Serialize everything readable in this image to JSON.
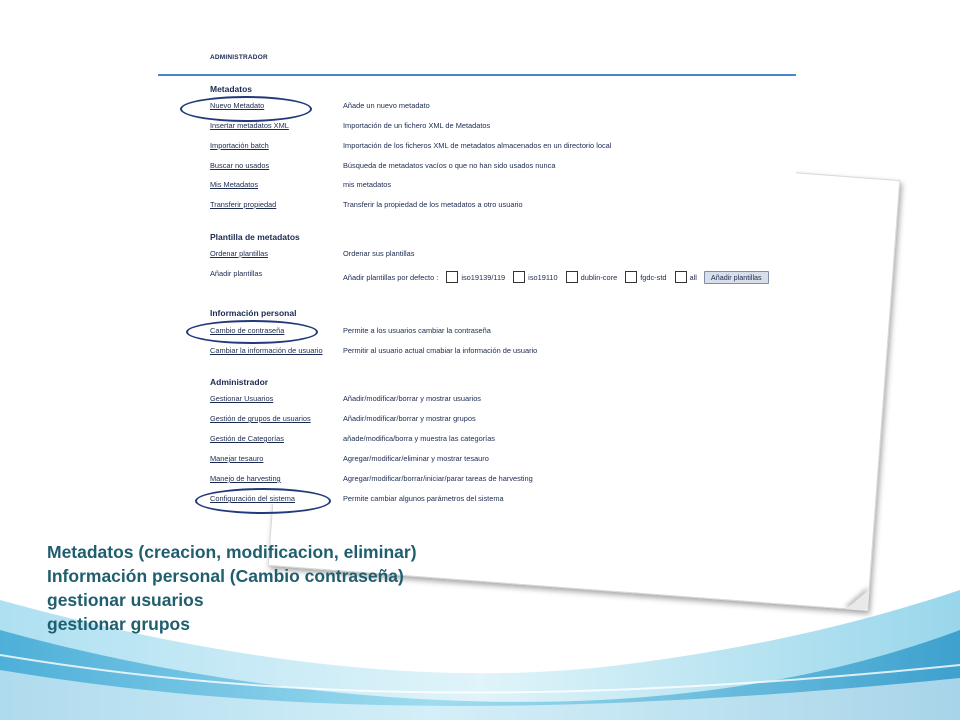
{
  "panel": {
    "title": "ADMINISTRADOR",
    "sections": {
      "metadatos": {
        "title": "Metadatos",
        "rows": [
          {
            "link": "Nuevo Metadato",
            "desc": "Añade un nuevo metadato"
          },
          {
            "link": "Insertar metadatos XML",
            "desc": "Importación de un fichero XML de Metadatos"
          },
          {
            "link": "Importación batch",
            "desc": "Importación de los ficheros XML de metadatos almacenados en un directorio local"
          },
          {
            "link": "Buscar no usados",
            "desc": "Búsqueda de metadatos vacíos o que no han sido usados nunca"
          },
          {
            "link": "Mis Metadatos",
            "desc": "mis metadatos"
          },
          {
            "link": "Transferir propiedad",
            "desc": "Transferir la propiedad de los metadatos a otro usuario"
          }
        ]
      },
      "plantilla": {
        "title": "Plantilla de metadatos",
        "ordenar": {
          "link": "Ordenar plantillas",
          "desc": "Ordenar sus plantillas"
        },
        "anadir": {
          "label": "Añadir plantillas",
          "default_label": "Añadir plantillas por defecto :",
          "options": [
            "iso19139/119",
            "iso19110",
            "dublin-core",
            "fgdc-std",
            "all"
          ],
          "button": "Añadir plantillas"
        }
      },
      "personal": {
        "title": "Información personal",
        "rows": [
          {
            "link": "Cambio de contraseña",
            "desc": "Permite a los usuarios cambiar la contraseña"
          },
          {
            "link": "Cambiar la información de usuario",
            "desc": "Permitir al usuario actual cmabiar la información de usuario"
          }
        ]
      },
      "administrador": {
        "title": "Administrador",
        "rows": [
          {
            "link": "Gestionar Usuarios",
            "desc": "Añadir/modificar/borrar y mostrar usuarios"
          },
          {
            "link": "Gestión de grupos de usuarios",
            "desc": "Añadir/modificar/borrar y mostrar grupos"
          },
          {
            "link": "Gestión de Categorías",
            "desc": "añade/modifica/borra y muestra las categorías"
          },
          {
            "link": "Manejar tesauro",
            "desc": "Agregar/modificar/eliminar y mostrar tesauro"
          },
          {
            "link": "Manejo de harvesting",
            "desc": "Agregar/modificar/borrar/iniciar/parar tareas de harvesting"
          },
          {
            "link": "Configuración del sistema",
            "desc": "Permite cambiar algunos parámetros del sistema"
          }
        ]
      }
    }
  },
  "bullets": [
    "Metadatos (creacion, modificacion, eliminar)",
    "Información personal (Cambio contraseña)",
    "gestionar usuarios",
    "gestionar grupos"
  ],
  "colors": {
    "text": "#1b2a50",
    "rule": "#4a86c5",
    "oval": "#233a7a",
    "bullet_text": "#1f5e6e",
    "wave_light": "#bfe6f2",
    "wave_mid": "#6ec6e4",
    "wave_deep": "#1f8fc4"
  }
}
